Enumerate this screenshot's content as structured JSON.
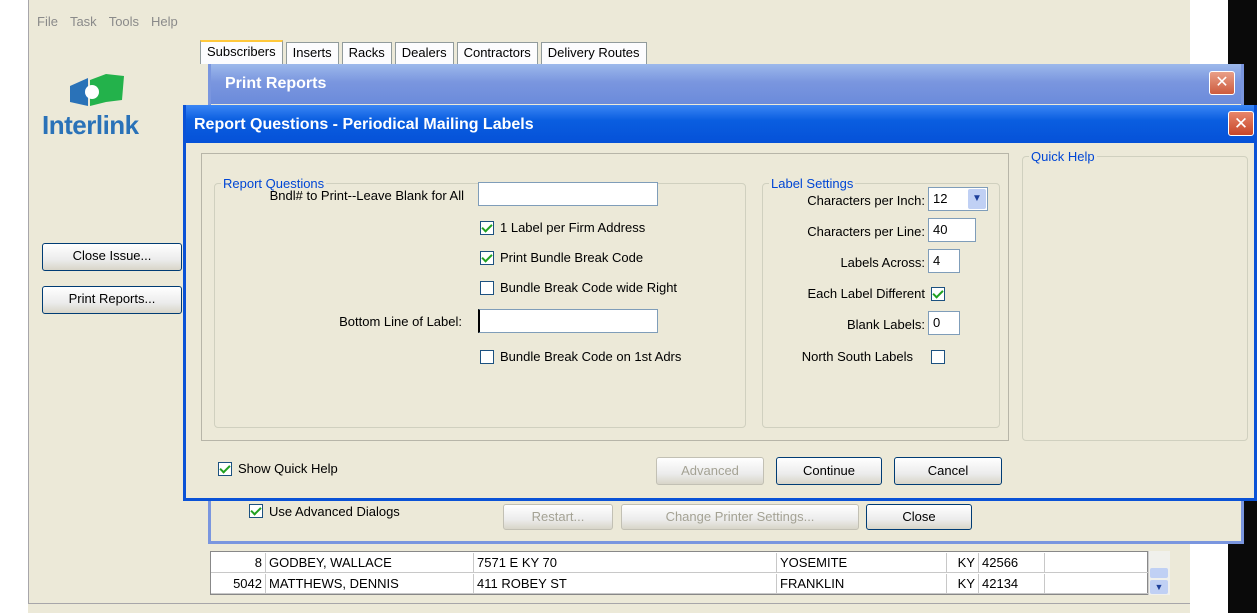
{
  "menu": [
    "File",
    "Task",
    "Tools",
    "Help"
  ],
  "logo": {
    "text": "Interlink"
  },
  "side_buttons": {
    "close_issue": "Close Issue...",
    "print_reports": "Print Reports..."
  },
  "tabs": [
    {
      "label": "Subscribers",
      "active": true
    },
    {
      "label": "Inserts"
    },
    {
      "label": "Racks"
    },
    {
      "label": "Dealers"
    },
    {
      "label": "Contractors"
    },
    {
      "label": "Delivery Routes"
    }
  ],
  "print_reports": {
    "title": "Print Reports",
    "use_advanced": "Use Advanced Dialogs",
    "restart": "Restart...",
    "change_printer": "Change Printer Settings...",
    "close": "Close"
  },
  "dialog": {
    "title": "Report Questions - Periodical Mailing Labels",
    "report_questions": {
      "legend": "Report Questions",
      "bundle_label": "Bndl# to Print--Leave Blank for All",
      "bundle_value": "",
      "label_per_firm": "1 Label per Firm Address",
      "print_bundle_break": "Print Bundle Break Code",
      "bundle_wide_right": "Bundle Break Code wide Right",
      "bottom_line_label": "Bottom Line of Label:",
      "bottom_line_value": "",
      "bundle_first_adrs": "Bundle Break Code on 1st Adrs"
    },
    "label_settings": {
      "legend": "Label Settings",
      "cpi_label": "Characters per Inch:",
      "cpi_value": "12",
      "cpl_label": "Characters per Line:",
      "cpl_value": "40",
      "across_label": "Labels Across:",
      "across_value": "4",
      "different_label": "Each Label Different",
      "blank_label": "Blank Labels:",
      "blank_value": "0",
      "north_south_label": "North South Labels"
    },
    "quick_help_legend": "Quick Help",
    "show_quick_help": "Show Quick Help",
    "advanced": "Advanced",
    "continue": "Continue",
    "cancel": "Cancel"
  },
  "rows": [
    {
      "id": "8",
      "name": "GODBEY, WALLACE",
      "address": "7571 E KY 70",
      "city": "YOSEMITE",
      "state": "KY",
      "zip": "42566"
    },
    {
      "id": "5042",
      "name": "MATTHEWS, DENNIS",
      "address": "411 ROBEY ST",
      "city": "FRANKLIN",
      "state": "KY",
      "zip": "42134"
    }
  ]
}
